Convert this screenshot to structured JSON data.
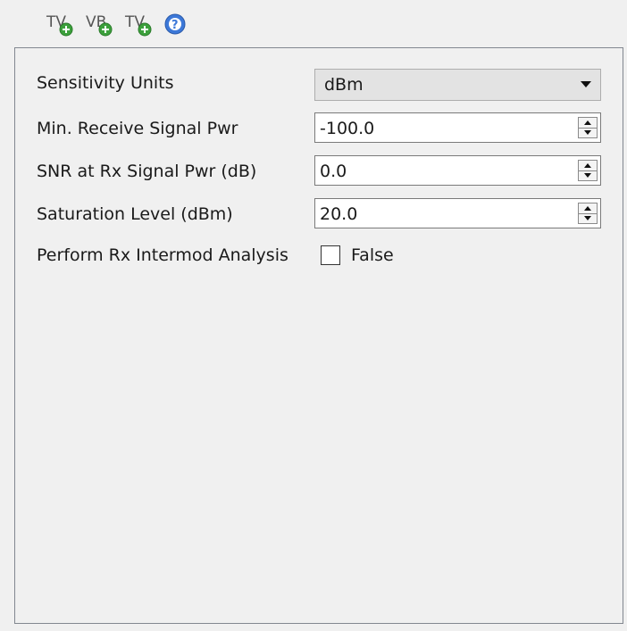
{
  "toolbar": {
    "buttons": [
      {
        "icon": "add-receiver-icon",
        "glyph": "TV"
      },
      {
        "icon": "add-variable-icon",
        "glyph": "VB"
      },
      {
        "icon": "add-transceiver-icon",
        "glyph": "TV"
      },
      {
        "icon": "help-icon",
        "glyph": "?"
      }
    ]
  },
  "properties": {
    "sensitivity_units": {
      "label": "Sensitivity Units",
      "value": "dBm"
    },
    "min_receive_signal_pwr": {
      "label": "Min. Receive Signal Pwr",
      "value": "-100.0"
    },
    "snr_at_rx_signal_pwr": {
      "label": "SNR at Rx Signal Pwr (dB)",
      "value": "0.0"
    },
    "saturation_level": {
      "label": "Saturation Level (dBm)",
      "value": "20.0"
    },
    "perform_rx_intermod": {
      "label": "Perform Rx Intermod Analysis",
      "checked": false,
      "value_text": "False"
    }
  },
  "colors": {
    "icon_gray": "#555555",
    "icon_green": "#3ca03c",
    "help_blue": "#3c78d8"
  }
}
